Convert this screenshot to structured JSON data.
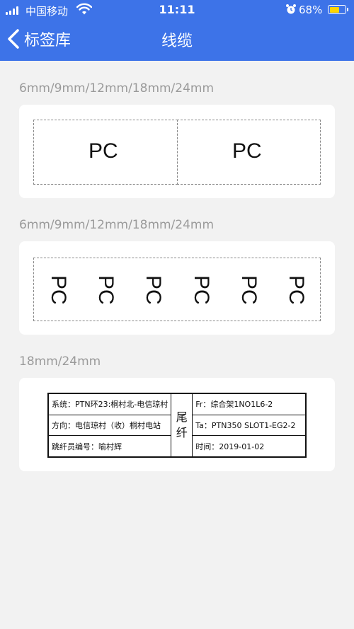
{
  "status": {
    "carrier": "中国移动",
    "time": "11:11",
    "battery": "68%",
    "battery_level": 0.68
  },
  "nav": {
    "back_label": "标签库",
    "title": "线缆"
  },
  "sections": [
    {
      "label": "6mm/9mm/12mm/18mm/24mm",
      "cells": [
        "PC",
        "PC"
      ]
    },
    {
      "label": "6mm/9mm/12mm/18mm/24mm",
      "cells": [
        "PC",
        "PC",
        "PC",
        "PC",
        "PC",
        "PC"
      ]
    },
    {
      "label": "18mm/24mm"
    }
  ],
  "fiber_label": {
    "left": [
      "系统：PTN环23:桐村北-电信琼村",
      "方向：电信琼村（收）桐村电站",
      "跳纤员编号：喻村辉"
    ],
    "middle": [
      "尾",
      "纤"
    ],
    "right": [
      "Fr：综合架1NO1L6-2",
      "Ta：PTN350 SLOT1-EG2-2",
      "时间：2019-01-02"
    ]
  },
  "colors": {
    "header": "#3d73e8",
    "background": "#f2f2f2",
    "card": "#ffffff",
    "section_label": "#9a9a9a"
  }
}
